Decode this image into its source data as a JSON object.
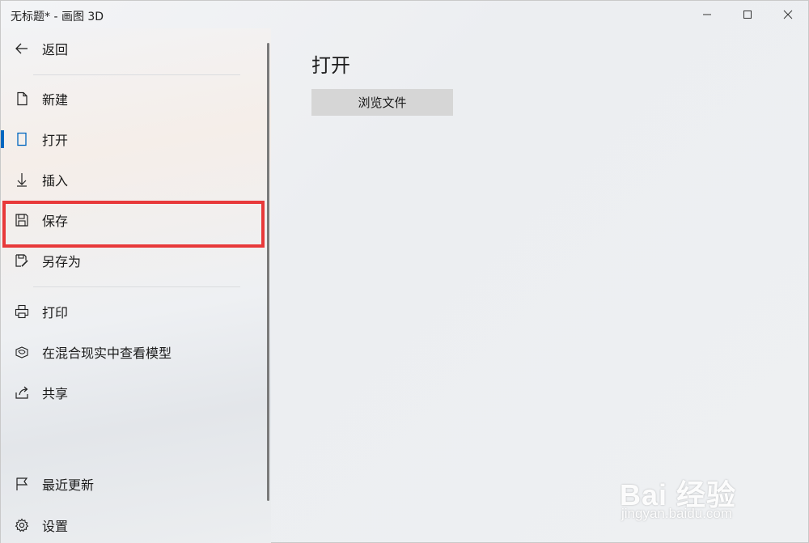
{
  "window": {
    "title": "无标题* - 画图 3D",
    "minimize_icon": "minimize-icon",
    "maximize_icon": "maximize-icon",
    "close_icon": "close-icon"
  },
  "sidebar": {
    "back": {
      "label": "返回",
      "icon": "back-arrow-icon"
    },
    "items": [
      {
        "label": "新建",
        "icon": "new-file-icon"
      },
      {
        "label": "打开",
        "icon": "open-icon",
        "active": true
      },
      {
        "label": "插入",
        "icon": "insert-icon"
      },
      {
        "label": "保存",
        "icon": "save-icon",
        "highlighted": true
      },
      {
        "label": "另存为",
        "icon": "save-as-icon"
      },
      {
        "label": "打印",
        "icon": "print-icon"
      },
      {
        "label": "在混合现实中查看模型",
        "icon": "mixed-reality-icon"
      },
      {
        "label": "共享",
        "icon": "share-icon"
      },
      {
        "label": "最近更新",
        "icon": "flag-icon"
      },
      {
        "label": "设置",
        "icon": "settings-icon"
      }
    ]
  },
  "main": {
    "title": "打开",
    "browse_button": "浏览文件"
  },
  "watermark": {
    "main": "Bai 经验",
    "sub": "jingyan.baidu.com"
  },
  "colors": {
    "accent": "#0067c0",
    "highlight_border": "#e8393a",
    "button_bg": "#d6d6d6"
  }
}
